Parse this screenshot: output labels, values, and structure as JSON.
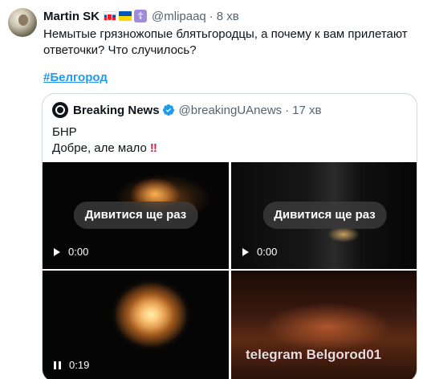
{
  "tweet": {
    "author_name": "Martin SK",
    "handle": "@mlipaaq",
    "separator": "·",
    "time": "8 хв",
    "text": "Немытые грязножопые блятьгородцы, а почему к вам прилетают ответочки? Что случилось?",
    "hashtag": "#Белгород"
  },
  "quote": {
    "author_name": "Breaking News",
    "handle": "@breakingUAnews",
    "separator": "·",
    "time": "17 хв",
    "line1": "БНР",
    "line2": "Добре, але мало",
    "exclaim": "‼"
  },
  "media": [
    {
      "replay_label": "Дивитися ще раз",
      "timestamp": "0:00",
      "state": "play"
    },
    {
      "replay_label": "Дивитися ще раз",
      "timestamp": "0:00",
      "state": "play"
    },
    {
      "timestamp": "0:19",
      "state": "pause"
    },
    {
      "watermark": "telegram Belgorod01"
    }
  ],
  "colors": {
    "link": "#1d9bf0",
    "secondary_text": "#536471",
    "verified": "#1d9bf0"
  }
}
